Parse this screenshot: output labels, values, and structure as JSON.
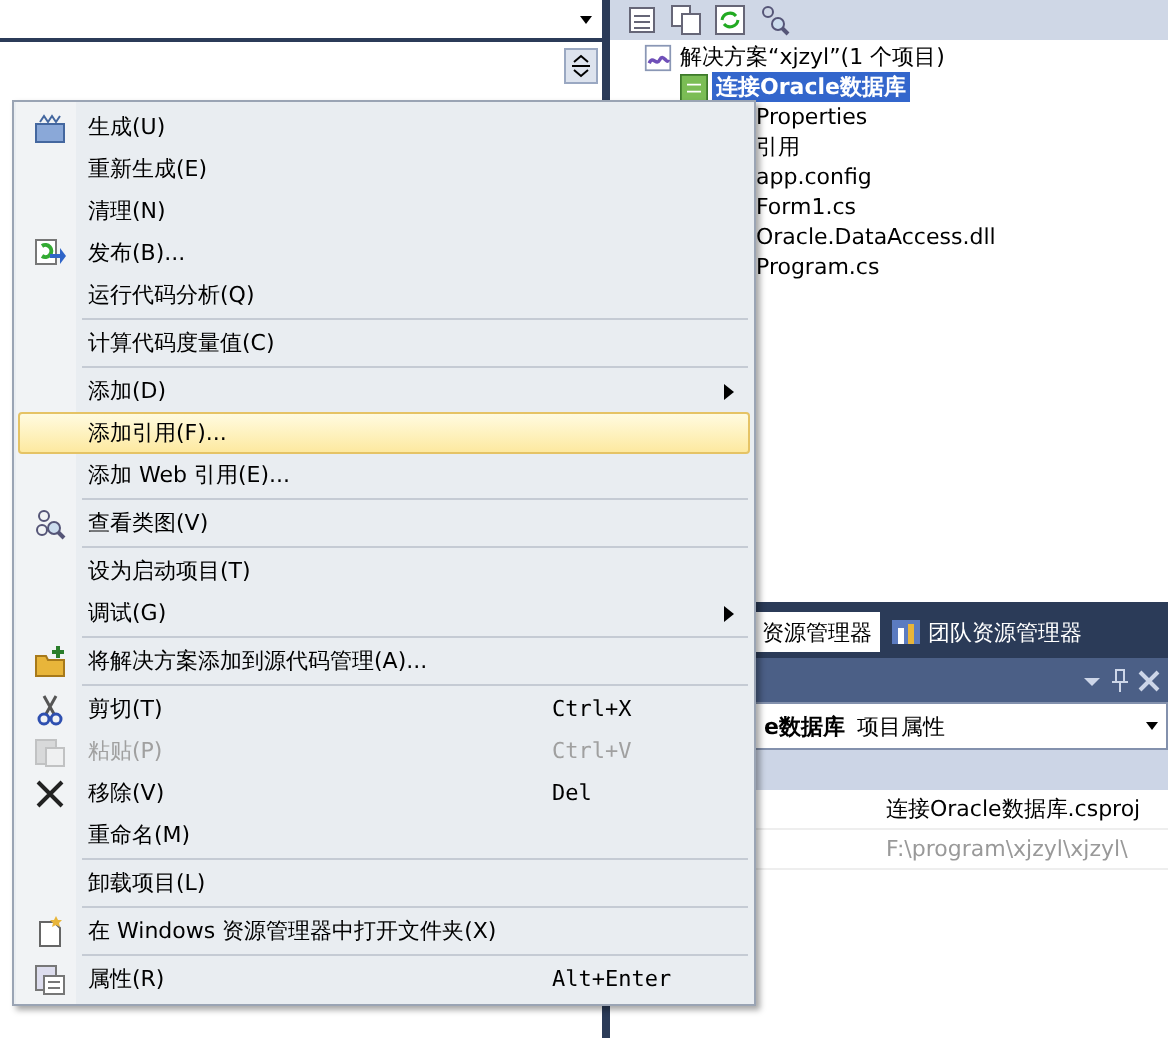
{
  "solution_explorer": {
    "tree": [
      {
        "label": "解决方案“xjzyl”(1 个项目)",
        "selected": false,
        "children": [
          {
            "label": "连接Oracle数据库",
            "selected": true,
            "children": [
              {
                "label": "Properties",
                "selected": false
              },
              {
                "label": "引用",
                "selected": false
              },
              {
                "label": "app.config",
                "selected": false
              },
              {
                "label": "Form1.cs",
                "selected": false
              },
              {
                "label": "Oracle.DataAccess.dll",
                "selected": false
              },
              {
                "label": "Program.cs",
                "selected": false
              }
            ]
          }
        ]
      }
    ]
  },
  "tabs": [
    {
      "label": "资源管理器",
      "selected": true
    },
    {
      "label": "团队资源管理器",
      "selected": false
    }
  ],
  "properties": {
    "object_bold": "e数据库",
    "object_type": "项目属性",
    "rows": [
      {
        "value": "连接Oracle数据库.csproj",
        "disabled": false
      },
      {
        "value": "F:\\program\\xjzyl\\xjzyl\\",
        "disabled": true
      }
    ]
  },
  "menu": {
    "items": [
      {
        "kind": "item",
        "label": "生成(U)",
        "selected": false,
        "disabled": false
      },
      {
        "kind": "item",
        "label": "重新生成(E)",
        "selected": false,
        "disabled": false
      },
      {
        "kind": "item",
        "label": "清理(N)",
        "selected": false,
        "disabled": false
      },
      {
        "kind": "item",
        "label": "发布(B)...",
        "selected": false,
        "disabled": false
      },
      {
        "kind": "item",
        "label": "运行代码分析(Q)",
        "selected": false,
        "disabled": false
      },
      {
        "kind": "separator"
      },
      {
        "kind": "item",
        "label": "计算代码度量值(C)",
        "selected": false,
        "disabled": false
      },
      {
        "kind": "separator"
      },
      {
        "kind": "item",
        "label": "添加(D)",
        "submenu": true,
        "selected": false,
        "disabled": false
      },
      {
        "kind": "item",
        "label": "添加引用(F)...",
        "selected": true,
        "disabled": false
      },
      {
        "kind": "item",
        "label": "添加 Web 引用(E)...",
        "selected": false,
        "disabled": false
      },
      {
        "kind": "separator"
      },
      {
        "kind": "item",
        "label": "查看类图(V)",
        "selected": false,
        "disabled": false
      },
      {
        "kind": "separator"
      },
      {
        "kind": "item",
        "label": "设为启动项目(T)",
        "selected": false,
        "disabled": false
      },
      {
        "kind": "item",
        "label": "调试(G)",
        "submenu": true,
        "selected": false,
        "disabled": false
      },
      {
        "kind": "separator"
      },
      {
        "kind": "item",
        "label": "将解决方案添加到源代码管理(A)...",
        "selected": false,
        "disabled": false
      },
      {
        "kind": "separator"
      },
      {
        "kind": "item",
        "label": "剪切(T)",
        "shortcut": "Ctrl+X",
        "selected": false,
        "disabled": false
      },
      {
        "kind": "item",
        "label": "粘贴(P)",
        "shortcut": "Ctrl+V",
        "selected": false,
        "disabled": true
      },
      {
        "kind": "item",
        "label": "移除(V)",
        "shortcut": "Del",
        "selected": false,
        "disabled": false
      },
      {
        "kind": "item",
        "label": "重命名(M)",
        "selected": false,
        "disabled": false
      },
      {
        "kind": "separator"
      },
      {
        "kind": "item",
        "label": "卸载项目(L)",
        "selected": false,
        "disabled": false
      },
      {
        "kind": "separator"
      },
      {
        "kind": "item",
        "label": "在 Windows 资源管理器中打开文件夹(X)",
        "selected": false,
        "disabled": false
      },
      {
        "kind": "separator"
      },
      {
        "kind": "item",
        "label": "属性(R)",
        "shortcut": "Alt+Enter",
        "selected": false,
        "disabled": false
      }
    ]
  }
}
